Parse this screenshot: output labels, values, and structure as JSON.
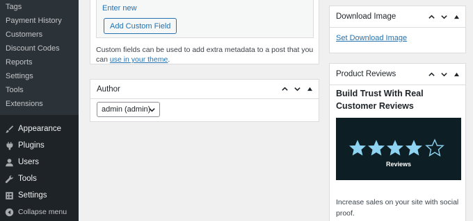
{
  "sidebar": {
    "submenu_items": [
      "Tags",
      "Payment History",
      "Customers",
      "Discount Codes",
      "Reports",
      "Settings",
      "Tools",
      "Extensions"
    ],
    "menu_items": [
      {
        "label": "Appearance",
        "icon": "paintbrush-icon"
      },
      {
        "label": "Plugins",
        "icon": "plugin-icon"
      },
      {
        "label": "Users",
        "icon": "users-icon"
      },
      {
        "label": "Tools",
        "icon": "wrench-icon"
      },
      {
        "label": "Settings",
        "icon": "settings-icon"
      }
    ],
    "collapse_label": "Collapse menu"
  },
  "custom_fields": {
    "enter_new_link": "Enter new",
    "add_button": "Add Custom Field",
    "help_text": "Custom fields can be used to add extra metadata to a post that you can",
    "help_link": "use in your theme",
    "help_end": "."
  },
  "author_box": {
    "title": "Author",
    "selected": "admin (admin)"
  },
  "download_box": {
    "title": "Download Image",
    "link": "Set Download Image"
  },
  "reviews_box": {
    "title": "Product Reviews",
    "heading": "Build Trust With Real Customer Reviews",
    "image_caption": "Reviews",
    "stars": 4.5,
    "description": "Increase sales on your site with social proof."
  },
  "colors": {
    "sidebar_bg": "#1d2327",
    "link": "#2271b1",
    "star": "#8fd3f3",
    "banner_bg": "#0d1f24"
  }
}
